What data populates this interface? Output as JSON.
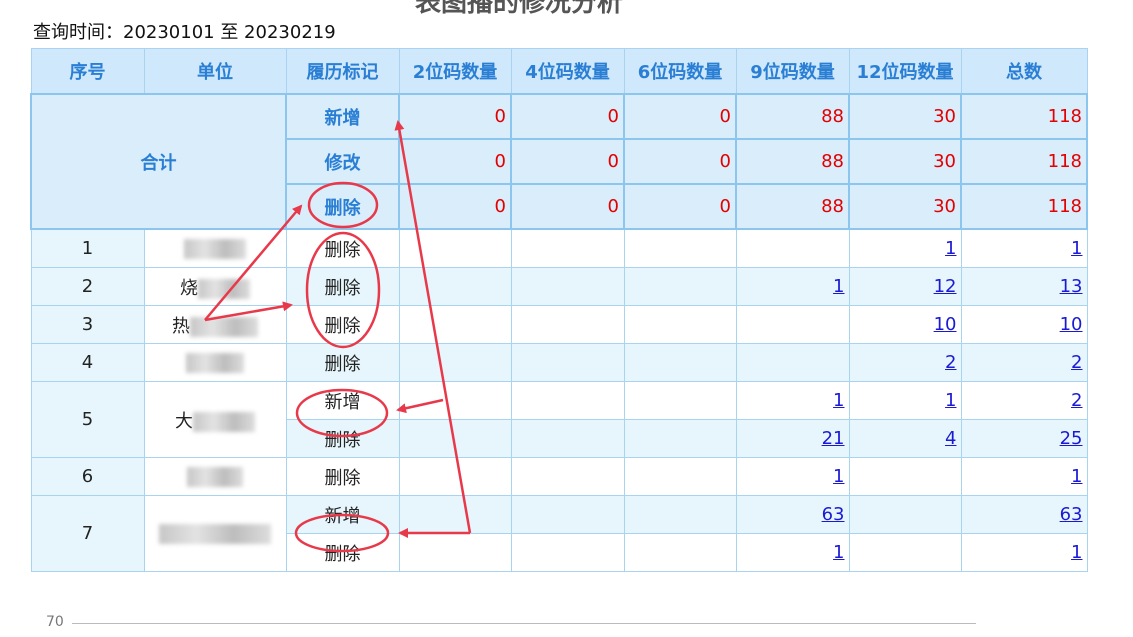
{
  "page_title": "表图播的修况分析",
  "query": "查询时间：20230101 至 20230219",
  "headers": [
    "序号",
    "单位",
    "履历标记",
    "2位码数量",
    "4位码数量",
    "6位码数量",
    "9位码数量",
    "12位码数量",
    "总数"
  ],
  "totals": {
    "label": "合计",
    "rows": [
      {
        "mark": "新增",
        "v2": "0",
        "v4": "0",
        "v6": "0",
        "v9": "88",
        "v12": "30",
        "total": "118"
      },
      {
        "mark": "修改",
        "v2": "0",
        "v4": "0",
        "v6": "0",
        "v9": "88",
        "v12": "30",
        "total": "118"
      },
      {
        "mark": "删除",
        "v2": "0",
        "v4": "0",
        "v6": "0",
        "v9": "88",
        "v12": "30",
        "total": "118"
      }
    ]
  },
  "rows": [
    {
      "no": "1",
      "unit_prefix": "",
      "mark": "删除",
      "v9": "",
      "v12": "1",
      "total": "1"
    },
    {
      "no": "2",
      "unit_prefix": "烧",
      "mark": "删除",
      "v9": "1",
      "v12": "12",
      "total": "13"
    },
    {
      "no": "3",
      "unit_prefix": "热",
      "mark": "删除",
      "v9": "",
      "v12": "10",
      "total": "10"
    },
    {
      "no": "4",
      "unit_prefix": "",
      "mark": "删除",
      "v9": "",
      "v12": "2",
      "total": "2"
    },
    {
      "no": "5",
      "unit_prefix": "大",
      "mark": "新增",
      "v9": "1",
      "v12": "1",
      "total": "2"
    },
    {
      "no": "",
      "unit_prefix": "",
      "mark": "删除",
      "v9": "21",
      "v12": "4",
      "total": "25"
    },
    {
      "no": "6",
      "unit_prefix": "",
      "mark": "删除",
      "v9": "1",
      "v12": "",
      "total": "1"
    },
    {
      "no": "7",
      "unit_prefix": "",
      "mark": "新增",
      "v9": "63",
      "v12": "",
      "total": "63"
    },
    {
      "no": "",
      "unit_prefix": "",
      "mark": "删除",
      "v9": "1",
      "v12": "",
      "total": "1"
    }
  ],
  "page_number": "70",
  "colors": {
    "header_bg": "#cfe8fb",
    "header_text": "#2a7fd4",
    "total_value": "#e30000",
    "link": "#1a1ad4",
    "annotation": "#e8394a"
  }
}
